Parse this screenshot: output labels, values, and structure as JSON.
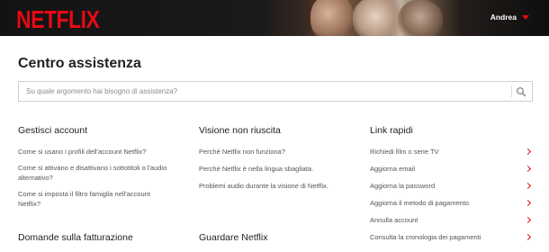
{
  "header": {
    "logo": "NETFLIX",
    "user_name": "Andrea"
  },
  "page": {
    "title": "Centro assistenza"
  },
  "search": {
    "placeholder": "Su quale argomento hai bisogno di assistenza?"
  },
  "sections": {
    "account": {
      "title": "Gestisci account",
      "items": [
        "Come si usano i profili dell'account Netflix?",
        "Come si attivano e disattivano i sottotitoli o l'audio alternativo?",
        "Come si imposta il filtro famiglia nell'account Netflix?"
      ]
    },
    "playback": {
      "title": "Visione non riuscita",
      "items": [
        "Perché Netflix non funziona?",
        "Perché Netflix è nella lingua sbagliata.",
        "Problemi audio durante la visione di Netflix."
      ]
    },
    "quick_links": {
      "title": "Link rapidi",
      "items": [
        "Richiedi film o serie TV",
        "Aggiorna email",
        "Aggiorna la password",
        "Aggiorna il metodo di pagamento",
        "Annulla account",
        "Consulta la cronologia dei pagamenti"
      ]
    },
    "billing": {
      "title": "Domande sulla fatturazione"
    },
    "watching": {
      "title": "Guardare Netflix"
    }
  },
  "colors": {
    "brand": "#e50914",
    "header_bg": "#141414"
  }
}
